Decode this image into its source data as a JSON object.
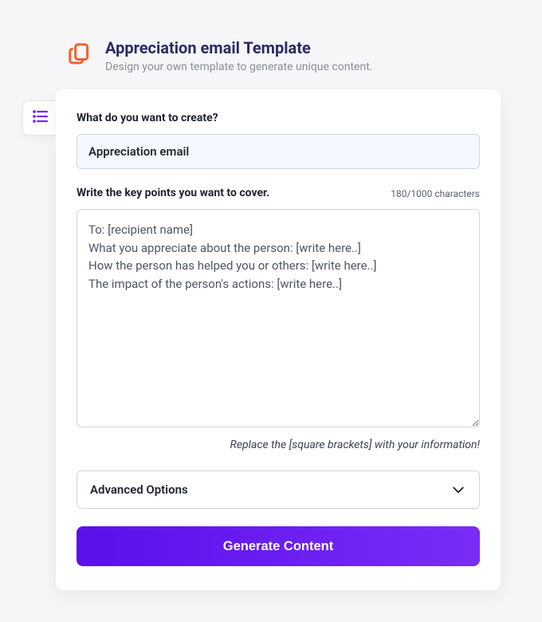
{
  "header": {
    "title": "Appreciation email Template",
    "subtitle": "Design your own template to generate unique content."
  },
  "form": {
    "create_label": "What do you want to create?",
    "create_value": "Appreciation email",
    "keypoints_label": "Write the key points you want to cover.",
    "char_count": "180/1000 characters",
    "keypoints_value": "To: [recipient name]\nWhat you appreciate about the person: [write here..]\nHow the person has helped you or others: [write here..]\nThe impact of the person's actions: [write here..]",
    "hint": "Replace the [square brackets] with your information!",
    "advanced_label": "Advanced Options",
    "generate_label": "Generate Content"
  },
  "colors": {
    "accent_start": "#5b10ea",
    "accent_end": "#7a2cf8",
    "icon_orange": "#f06332",
    "title_navy": "#2a2a65",
    "side_purple": "#7a2cf8"
  }
}
